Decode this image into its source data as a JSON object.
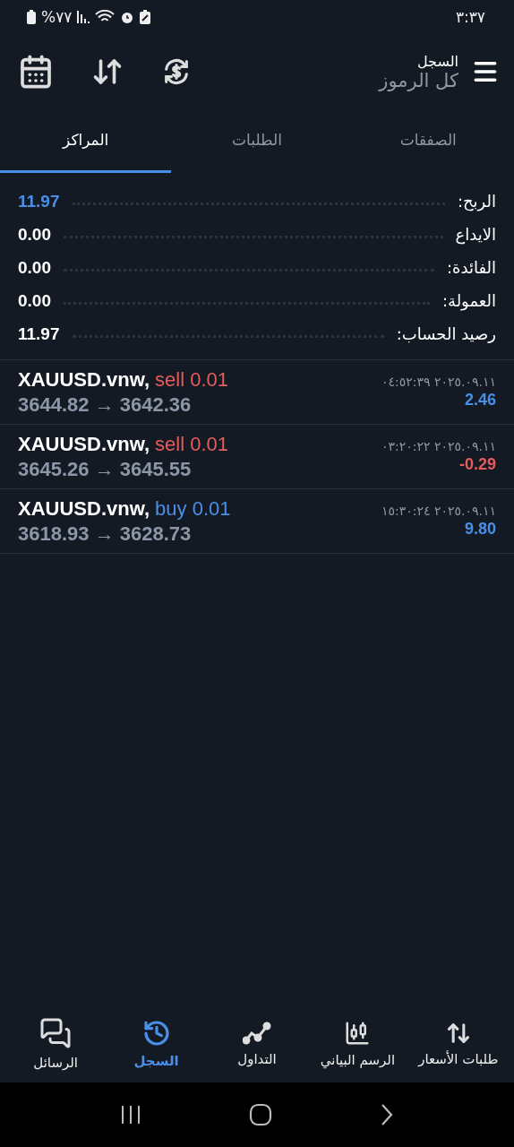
{
  "status_bar": {
    "time": "٣:٣٧",
    "battery": "%٧٧"
  },
  "header": {
    "title": "السجل",
    "subtitle": "كل الرموز"
  },
  "tabs": [
    {
      "label": "الصفقات",
      "selected": false
    },
    {
      "label": "الطلبات",
      "selected": false
    },
    {
      "label": "المراكز",
      "selected": true
    }
  ],
  "summary": [
    {
      "label": "الربح:",
      "value": "11.97",
      "highlight": true
    },
    {
      "label": "الايداع",
      "value": "0.00",
      "highlight": false
    },
    {
      "label": "الفائدة:",
      "value": "0.00",
      "highlight": false
    },
    {
      "label": "العمولة:",
      "value": "0.00",
      "highlight": false
    },
    {
      "label": "رصيد الحساب:",
      "value": "11.97",
      "highlight": false
    }
  ],
  "trades": [
    {
      "symbol": "XAUUSD.vnw,",
      "kind": "sell",
      "order": "sell 0.01",
      "prices": "3644.82 → 3642.36",
      "time": "٢٠٢٥.٠٩.١١ ٠٤:٥٢:٣٩",
      "profit": "2.46",
      "loss": false
    },
    {
      "symbol": "XAUUSD.vnw,",
      "kind": "sell",
      "order": "sell 0.01",
      "prices": "3645.26 → 3645.55",
      "time": "٢٠٢٥.٠٩.١١ ٠٣:٢٠:٢٢",
      "profit": "-0.29",
      "loss": true
    },
    {
      "symbol": "XAUUSD.vnw,",
      "kind": "buy",
      "order": "buy 0.01",
      "prices": "3618.93 → 3628.73",
      "time": "٢٠٢٥.٠٩.١١ ١٥:٣٠:٢٤",
      "profit": "9.80",
      "loss": false
    }
  ],
  "bottom_nav": [
    {
      "label": "طلبات الأسعار",
      "kind": "quotes",
      "selected": false
    },
    {
      "label": "الرسم البياني",
      "kind": "chart",
      "selected": false
    },
    {
      "label": "التداول",
      "kind": "trade",
      "selected": false
    },
    {
      "label": "السجل",
      "kind": "history",
      "selected": true
    },
    {
      "label": "الرسائل",
      "kind": "messages",
      "selected": false
    }
  ]
}
